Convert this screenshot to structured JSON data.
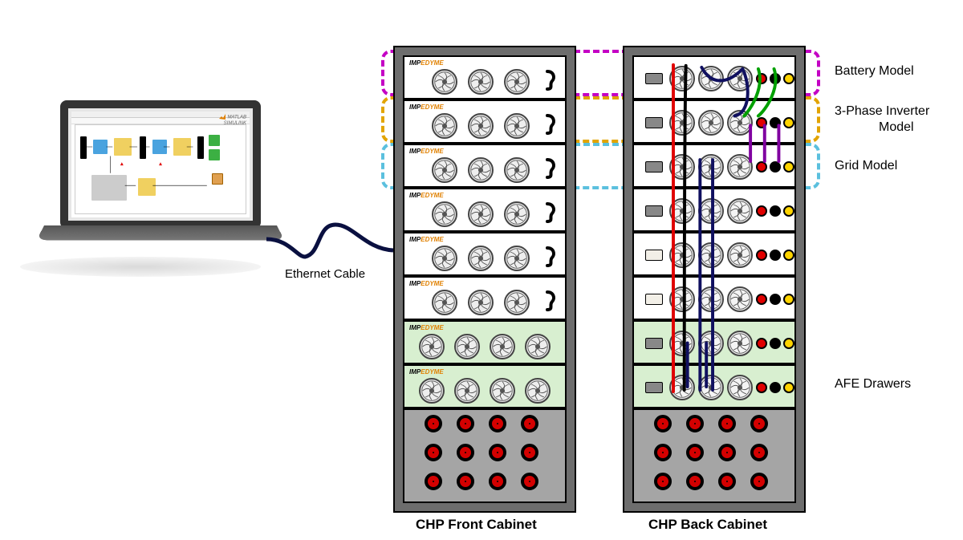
{
  "brand": {
    "line1": "MATLAB",
    "line2": "SIMULINK"
  },
  "ethernet_label": "Ethernet Cable",
  "captions": {
    "front": "CHP Front Cabinet",
    "back": "CHP Back Cabinet"
  },
  "zones": {
    "battery": {
      "label": "Battery Model"
    },
    "inverter": {
      "label1": "3-Phase Inverter",
      "label2": "Model"
    },
    "grid": {
      "label": "Grid Model"
    },
    "afe": {
      "label": "AFE Drawers"
    }
  },
  "front_logo": {
    "part1": "IMP",
    "part2": "EDYME"
  },
  "colors": {
    "battery": "#c400c4",
    "inverter": "#e2a400",
    "grid": "#5bc0de",
    "wire_red": "#e00000",
    "wire_navy": "#101060",
    "wire_green": "#00a000",
    "wire_black": "#000000",
    "wire_purple": "#8000a0"
  },
  "front_drawers": [
    {
      "type": "std3"
    },
    {
      "type": "std3"
    },
    {
      "type": "std3"
    },
    {
      "type": "std3"
    },
    {
      "type": "std3"
    },
    {
      "type": "std3"
    },
    {
      "type": "afe4"
    },
    {
      "type": "afe4"
    }
  ],
  "back_drawers": [
    {
      "conn": "dark"
    },
    {
      "conn": "dark"
    },
    {
      "conn": "dark"
    },
    {
      "conn": "dark"
    },
    {
      "conn": "light"
    },
    {
      "conn": "light"
    },
    {
      "conn": "dark",
      "green": true
    },
    {
      "conn": "dark",
      "green": true
    }
  ],
  "jack_colors": [
    "red",
    "black",
    "yellow",
    "blue"
  ]
}
